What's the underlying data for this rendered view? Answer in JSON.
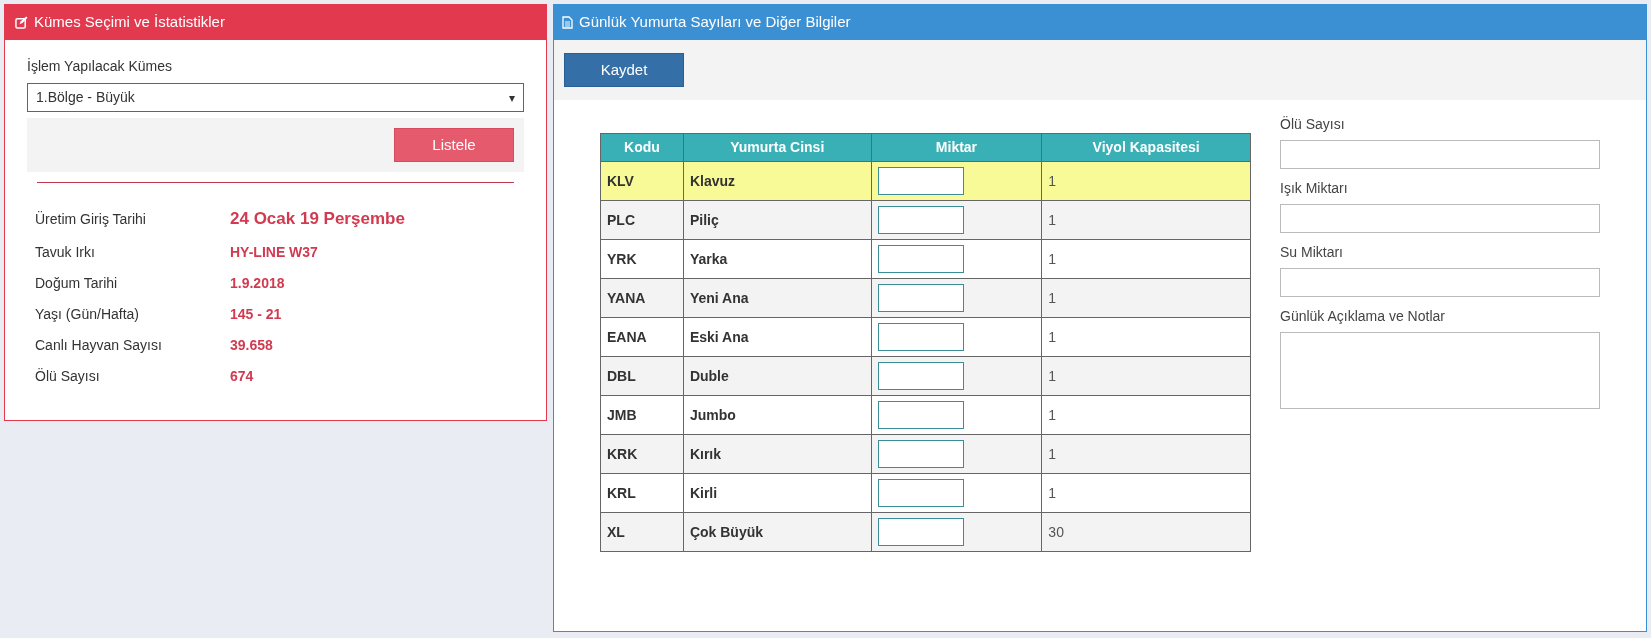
{
  "left_panel": {
    "title": "Kümes Seçimi ve İstatistikler",
    "select_label": "İşlem Yapılacak Kümes",
    "select_value": "1.Bölge - Büyük",
    "select_caret": "▾",
    "list_button": "Listele",
    "stats": [
      {
        "label": "Üretim Giriş Tarihi",
        "value": "24 Ocak 19 Perşembe",
        "kind": "large"
      },
      {
        "label": "Tavuk Irkı",
        "value": "HY-LINE W37",
        "kind": "normal"
      },
      {
        "label": "Doğum Tarihi",
        "value": "1.9.2018",
        "kind": "normal"
      },
      {
        "label": "Yaşı (Gün/Hafta)",
        "value": "145 - 21",
        "kind": "normal"
      },
      {
        "label": "Canlı Hayvan Sayısı",
        "value": "39.658",
        "kind": "normal"
      },
      {
        "label": "Ölü Sayısı",
        "value": "674",
        "kind": "normal"
      }
    ]
  },
  "right_panel": {
    "title": "Günlük Yumurta Sayıları ve Diğer Bilgiler",
    "save_button": "Kaydet",
    "table": {
      "columns": [
        "Kodu",
        "Yumurta Cinsi",
        "Miktar",
        "Viyol Kapasitesi"
      ],
      "rows": [
        {
          "code": "KLV",
          "type": "Klavuz",
          "capacity": "1",
          "selected": true
        },
        {
          "code": "PLC",
          "type": "Piliç",
          "capacity": "1",
          "selected": false
        },
        {
          "code": "YRK",
          "type": "Yarka",
          "capacity": "1",
          "selected": false
        },
        {
          "code": "YANA",
          "type": "Yeni Ana",
          "capacity": "1",
          "selected": false
        },
        {
          "code": "EANA",
          "type": "Eski Ana",
          "capacity": "1",
          "selected": false
        },
        {
          "code": "DBL",
          "type": "Duble",
          "capacity": "1",
          "selected": false
        },
        {
          "code": "JMB",
          "type": "Jumbo",
          "capacity": "1",
          "selected": false
        },
        {
          "code": "KRK",
          "type": "Kırık",
          "capacity": "1",
          "selected": false
        },
        {
          "code": "KRL",
          "type": "Kirli",
          "capacity": "1",
          "selected": false
        },
        {
          "code": "XL",
          "type": "Çok Büyük",
          "capacity": "30",
          "selected": false
        }
      ]
    },
    "fields": [
      {
        "label": "Ölü Sayısı",
        "kind": "input"
      },
      {
        "label": "Işık Miktarı",
        "kind": "input"
      },
      {
        "label": "Su Miktarı",
        "kind": "input"
      },
      {
        "label": "Günlük Açıklama ve Notlar",
        "kind": "textarea"
      }
    ]
  }
}
